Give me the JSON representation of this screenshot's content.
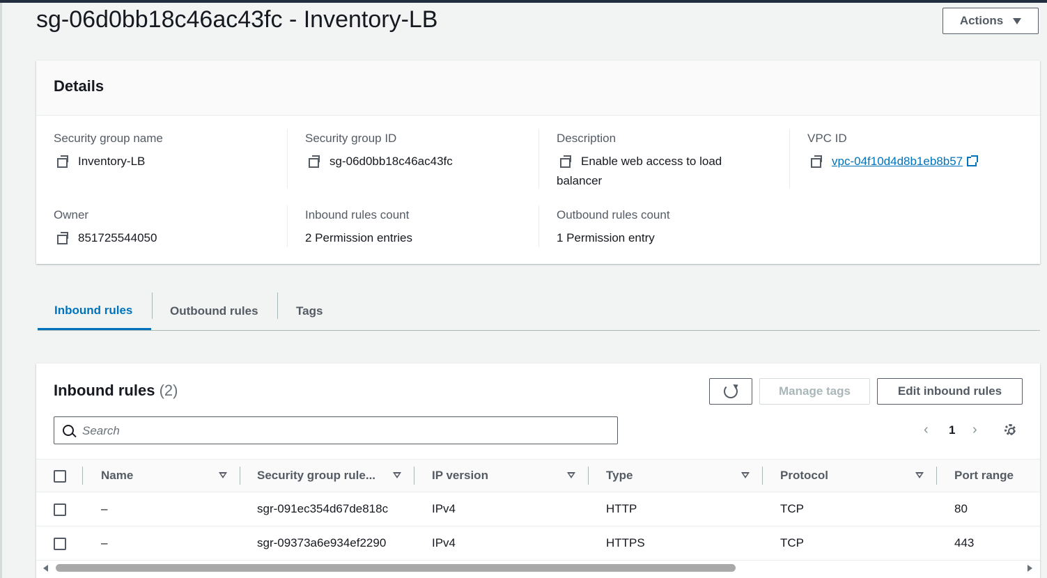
{
  "page": {
    "title": "sg-06d0bb18c46ac43fc - Inventory-LB",
    "actions_label": "Actions"
  },
  "details": {
    "title": "Details",
    "fields": {
      "sg_name": {
        "label": "Security group name",
        "value": "Inventory-LB"
      },
      "sg_id": {
        "label": "Security group ID",
        "value": "sg-06d0bb18c46ac43fc"
      },
      "description": {
        "label": "Description",
        "value": "Enable web access to load balancer"
      },
      "vpc_id": {
        "label": "VPC ID",
        "value": "vpc-04f10d4d8b1eb8b57"
      },
      "owner": {
        "label": "Owner",
        "value": "851725544050"
      },
      "inbound_count": {
        "label": "Inbound rules count",
        "value": "2 Permission entries"
      },
      "outbound_count": {
        "label": "Outbound rules count",
        "value": "1 Permission entry"
      }
    }
  },
  "tabs": [
    {
      "label": "Inbound rules",
      "active": true
    },
    {
      "label": "Outbound rules",
      "active": false
    },
    {
      "label": "Tags",
      "active": false
    }
  ],
  "rules": {
    "title": "Inbound rules",
    "count": "(2)",
    "manage_tags_label": "Manage tags",
    "edit_label": "Edit inbound rules",
    "search_placeholder": "Search",
    "page_number": "1",
    "columns": [
      "Name",
      "Security group rule...",
      "IP version",
      "Type",
      "Protocol",
      "Port range"
    ],
    "rows": [
      {
        "name": "–",
        "rule_id": "sgr-091ec354d67de818c",
        "ip_version": "IPv4",
        "type": "HTTP",
        "protocol": "TCP",
        "port_range": "80"
      },
      {
        "name": "–",
        "rule_id": "sgr-09373a6e934ef2290",
        "ip_version": "IPv4",
        "type": "HTTPS",
        "protocol": "TCP",
        "port_range": "443"
      }
    ]
  },
  "colors": {
    "accent": "#0073bb",
    "text": "#16191f",
    "muted": "#545b64",
    "topbar": "#232f3e"
  },
  "icons": [
    "copy-icon",
    "external-link-icon",
    "refresh-icon",
    "search-icon",
    "chevron-left-icon",
    "chevron-right-icon",
    "settings-gear-icon",
    "sort-caret-icon",
    "caret-down-icon"
  ]
}
